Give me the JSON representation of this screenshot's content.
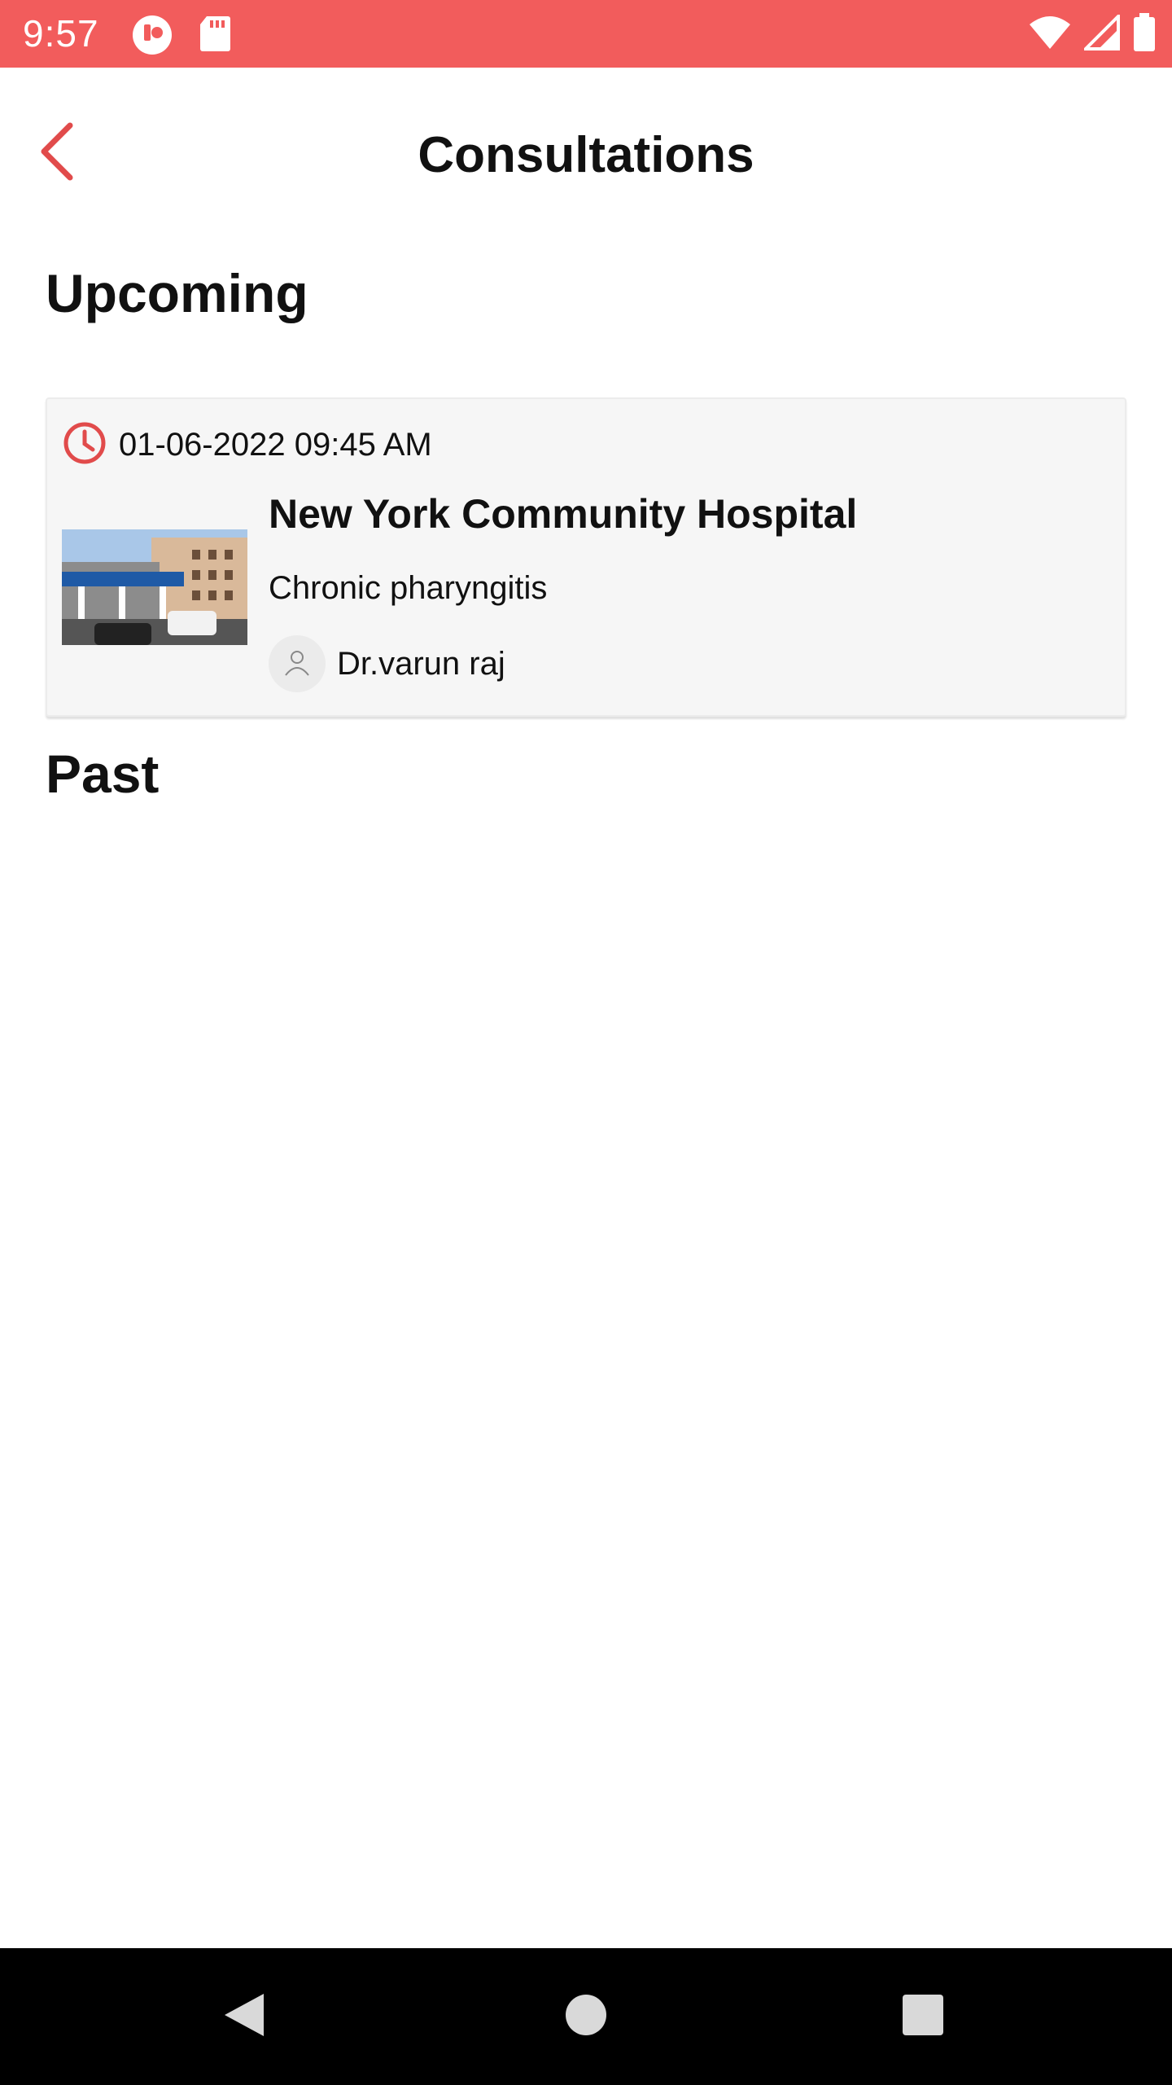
{
  "status_bar": {
    "time": "9:57",
    "background_color": "#f25c5c",
    "icons": [
      "app-notification-icon",
      "sd-card-icon",
      "wifi-icon",
      "cellular-signal-icon",
      "battery-icon"
    ]
  },
  "header": {
    "title": "Consultations",
    "back_icon": "chevron-left-icon",
    "accent_color": "#e14b4b"
  },
  "sections": {
    "upcoming_label": "Upcoming",
    "past_label": "Past"
  },
  "upcoming": [
    {
      "datetime": "01-06-2022 09:45 AM",
      "hospital": "New York Community Hospital",
      "diagnosis": "Chronic pharyngitis",
      "doctor": "Dr.varun raj",
      "clock_icon": "clock-icon",
      "avatar_icon": "person-icon"
    }
  ],
  "nav_bar": {
    "buttons": [
      "back-triangle-icon",
      "home-circle-icon",
      "recents-square-icon"
    ]
  }
}
